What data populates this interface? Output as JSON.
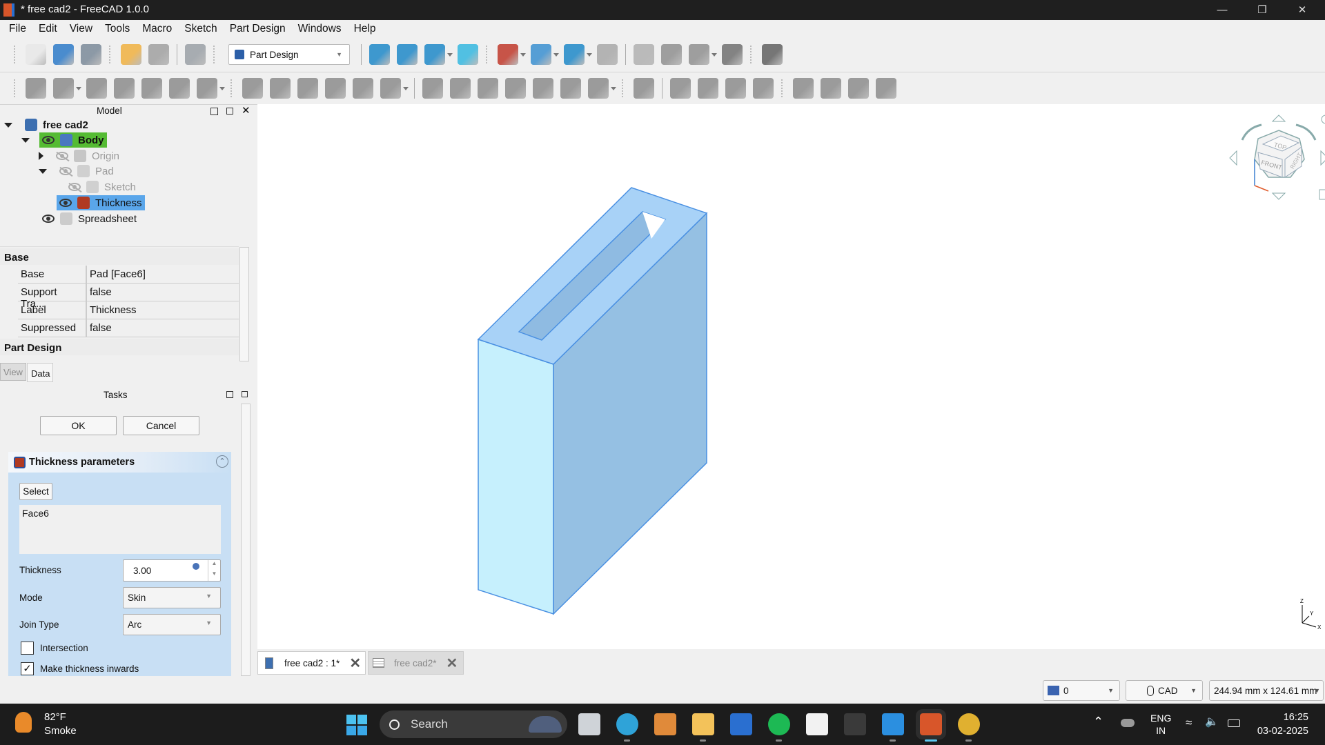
{
  "window": {
    "title": "* free cad2 - FreeCAD 1.0.0"
  },
  "menu": [
    "File",
    "Edit",
    "View",
    "Tools",
    "Macro",
    "Sketch",
    "Part Design",
    "Windows",
    "Help"
  ],
  "toolbar1": {
    "groups": [
      [
        {
          "icon": "new-document-icon",
          "color": "#e8e8e8"
        },
        {
          "icon": "open-document-icon",
          "color": "#2d7ac8"
        },
        {
          "icon": "save-icon",
          "color": "#7b8a99"
        }
      ],
      [
        {
          "icon": "undo-icon",
          "color": "#f0b040"
        },
        {
          "icon": "redo-icon",
          "color": "#a0a0a0"
        }
      ],
      [
        {
          "icon": "refresh-icon",
          "color": "#9aa0a6"
        }
      ],
      [
        "WORKBENCH"
      ],
      [
        {
          "icon": "fit-all-icon",
          "color": "#1e88c8"
        },
        {
          "icon": "fit-selection-icon",
          "color": "#1e88c8"
        },
        {
          "icon": "standard-views-icon",
          "color": "#1e88c8",
          "dd": true
        },
        {
          "icon": "sketch-view-icon",
          "color": "#35b8e0"
        }
      ],
      [
        {
          "icon": "draw-style-icon",
          "color": "#c0392b",
          "dd": true
        },
        {
          "icon": "bounding-box-icon",
          "color": "#3a8fd0",
          "dd": true
        },
        {
          "icon": "zoom-icon",
          "color": "#1e88c8",
          "dd": true
        },
        {
          "icon": "measure-icon",
          "color": "#a8a8a8"
        }
      ],
      [
        {
          "icon": "create-part-icon",
          "color": "#b0b0b0"
        },
        {
          "icon": "create-group-icon",
          "color": "#909090"
        },
        {
          "icon": "make-link-icon",
          "color": "#909090",
          "dd": true
        },
        {
          "icon": "macro-icon",
          "color": "#707070"
        }
      ],
      [
        {
          "icon": "whats-this-icon",
          "color": "#606060"
        }
      ]
    ],
    "workbench": "Part Design"
  },
  "toolbar2": {
    "groups": [
      [
        {
          "icon": "create-body-icon"
        },
        {
          "icon": "create-sketch-icon",
          "dd": true
        },
        {
          "icon": "validate-sketch-icon"
        },
        {
          "icon": "datum-point-icon"
        },
        {
          "icon": "datum-line-icon"
        },
        {
          "icon": "datum-plane-icon"
        },
        {
          "icon": "sub-shape-binder-icon",
          "dd": true
        }
      ],
      [
        {
          "icon": "pad-icon"
        },
        {
          "icon": "revolution-icon"
        },
        {
          "icon": "additive-loft-icon"
        },
        {
          "icon": "additive-pipe-icon"
        },
        {
          "icon": "additive-helix-icon"
        },
        {
          "icon": "additive-primitive-icon",
          "dd": true
        }
      ],
      [
        {
          "icon": "pocket-icon"
        },
        {
          "icon": "hole-icon"
        },
        {
          "icon": "groove-icon"
        },
        {
          "icon": "subtractive-loft-icon"
        },
        {
          "icon": "subtractive-pipe-icon"
        },
        {
          "icon": "subtractive-helix-icon"
        },
        {
          "icon": "subtractive-primitive-icon",
          "dd": true
        }
      ],
      [
        {
          "icon": "boolean-icon"
        }
      ],
      [
        {
          "icon": "fillet-icon"
        },
        {
          "icon": "chamfer-icon"
        },
        {
          "icon": "draft-icon"
        },
        {
          "icon": "thickness-icon"
        }
      ],
      [
        {
          "icon": "mirrored-icon"
        },
        {
          "icon": "linear-pattern-icon"
        },
        {
          "icon": "polar-pattern-icon"
        },
        {
          "icon": "multi-transform-icon"
        }
      ]
    ]
  },
  "model_panel": {
    "title": "Model",
    "tree": [
      {
        "label": "free cad2",
        "level": 0,
        "expander": "down",
        "bold": true,
        "icon": "document-icon"
      },
      {
        "label": "Body",
        "level": 1,
        "expander": "down",
        "bold": true,
        "visible": true,
        "icon": "body-icon",
        "highlight": "#55bb33"
      },
      {
        "label": "Origin",
        "level": 2,
        "expander": "right",
        "visible": false,
        "icon": "origin-icon",
        "dim": true
      },
      {
        "label": "Pad",
        "level": 2,
        "expander": "down",
        "visible": false,
        "icon": "pad-icon",
        "dim": true
      },
      {
        "label": "Sketch",
        "level": 3,
        "visible": false,
        "icon": "sketch-icon",
        "dim": true
      },
      {
        "label": "Thickness",
        "level": 2,
        "visible": true,
        "icon": "thickness-icon",
        "selected": true
      },
      {
        "label": "Spreadsheet",
        "level": 1,
        "visible": true,
        "icon": "spreadsheet-icon"
      }
    ]
  },
  "properties": {
    "groups": [
      {
        "name": "Base",
        "rows": [
          {
            "key": "Base",
            "value": "Pad [Face6]"
          },
          {
            "key": "Support Tra...",
            "value": "false"
          },
          {
            "key": "Label",
            "value": "Thickness"
          },
          {
            "key": "Suppressed",
            "value": "false"
          }
        ]
      },
      {
        "name": "Part Design",
        "rows": []
      }
    ],
    "tabs": [
      "View",
      "Data"
    ],
    "active_tab": "Data"
  },
  "tasks": {
    "title": "Tasks",
    "ok": "OK",
    "cancel": "Cancel",
    "panel_title": "Thickness parameters",
    "select_button": "Select",
    "faces": [
      "Face6"
    ],
    "thickness_label": "Thickness",
    "thickness_value": "3.00",
    "mode_label": "Mode",
    "mode_value": "Skin",
    "join_label": "Join Type",
    "join_value": "Arc",
    "intersection_label": "Intersection",
    "intersection_checked": false,
    "inwards_label": "Make thickness inwards",
    "inwards_checked": true
  },
  "viewport": {
    "navcube": {
      "top": "TOP",
      "front": "FRONT",
      "right": "RIGHT"
    },
    "axes": {
      "x": "X",
      "y": "Y",
      "z": "Z"
    },
    "colors": {
      "front": "#c6f0fd",
      "right": "#95c0e3",
      "top": "#a8d2f7",
      "edge": "#4a90e2"
    }
  },
  "doc_tabs": [
    {
      "label": "free cad2 : 1*",
      "active": true,
      "icon": "document-icon"
    },
    {
      "label": "free cad2*",
      "active": false,
      "icon": "spreadsheet-icon"
    }
  ],
  "statusbar": {
    "draw_style": "0",
    "nav_style": "CAD",
    "dimensions": "244.94 mm x 124.61 mm"
  },
  "taskbar": {
    "weather_temp": "82°F",
    "weather_desc": "Smoke",
    "search": "Search",
    "apps": [
      {
        "icon": "task-view-icon",
        "color": "#cfd3d8"
      },
      {
        "icon": "edge-icon",
        "color": "#2fa3d8"
      },
      {
        "icon": "copilot-icon",
        "color": "#e08a3a"
      },
      {
        "icon": "file-explorer-icon",
        "color": "#f3c25a"
      },
      {
        "icon": "mathcad-icon",
        "color": "#2a6fd0"
      },
      {
        "icon": "spotify-icon",
        "color": "#1db954"
      },
      {
        "icon": "microsoft-store-icon",
        "color": "#f2f2f2"
      },
      {
        "icon": "terminal-icon",
        "color": "#3a3a3a"
      },
      {
        "icon": "vscode-icon",
        "color": "#2b8fe0"
      },
      {
        "icon": "freecad-icon",
        "color": "#d8562a"
      },
      {
        "icon": "chrome-icon",
        "color": "#e0b030"
      }
    ],
    "lang": "ENG",
    "region": "IN",
    "time": "16:25",
    "date": "03-02-2025"
  }
}
